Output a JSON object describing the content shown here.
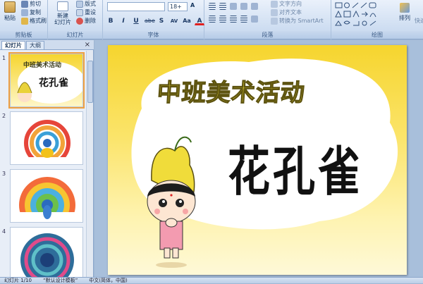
{
  "ribbon": {
    "clipboard": {
      "paste": "粘贴",
      "cut": "剪切",
      "copy": "复制",
      "format_painter": "格式刷",
      "label": "剪贴板"
    },
    "slides": {
      "new_slide": "新建\n幻灯片",
      "layout": "版式",
      "reset": "重设",
      "delete": "删除",
      "label": "幻灯片"
    },
    "font": {
      "font_name": "",
      "font_size": "18+",
      "label": "字体",
      "bold": "B",
      "italic": "I",
      "underline": "U",
      "strike": "abe",
      "shadow": "S",
      "spacing": "AV",
      "case": "Aa",
      "color": "A"
    },
    "paragraph": {
      "text_direction": "文字方向",
      "align_text": "对齐文本",
      "smartart": "转换为 SmartArt",
      "label": "段落"
    },
    "drawing": {
      "arrange": "排列",
      "quick_styles": "快速",
      "label": "绘图"
    }
  },
  "panel": {
    "tabs": [
      {
        "label": "幻灯片"
      },
      {
        "label": "大纲"
      }
    ],
    "close": "×"
  },
  "thumbnails": [
    {
      "num": "1",
      "title": "中班美术活动",
      "subtitle": "花孔雀"
    },
    {
      "num": "2"
    },
    {
      "num": "3"
    },
    {
      "num": "4"
    }
  ],
  "slide": {
    "title": "中班美术活动",
    "main_text": "花孔雀"
  },
  "status": {
    "slide_info": "幻灯片 1/10",
    "theme": "“默认设计模板”",
    "language": "中文(简体，中国)"
  }
}
